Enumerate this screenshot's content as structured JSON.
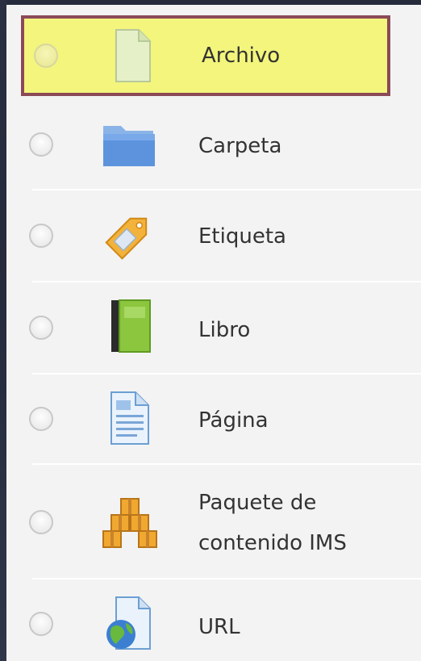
{
  "modules": [
    {
      "label": "Archivo",
      "icon": "file-icon",
      "selected": true
    },
    {
      "label": "Carpeta",
      "icon": "folder-icon",
      "selected": false
    },
    {
      "label": "Etiqueta",
      "icon": "tag-label-icon",
      "selected": false
    },
    {
      "label": "Libro",
      "icon": "book-icon",
      "selected": false
    },
    {
      "label": "Página",
      "icon": "page-icon",
      "selected": false
    },
    {
      "label_line1": "Paquete de",
      "label_line2": "contenido IMS",
      "icon": "ims-package-icon",
      "selected": false
    },
    {
      "label": "URL",
      "icon": "url-globe-icon",
      "selected": false
    }
  ],
  "colors": {
    "panel_bg": "#f3f3f3",
    "selected_bg": "#f3f57c",
    "selected_border": "#8b4a57",
    "text": "#333333",
    "dark_bg": "#1c2230"
  }
}
